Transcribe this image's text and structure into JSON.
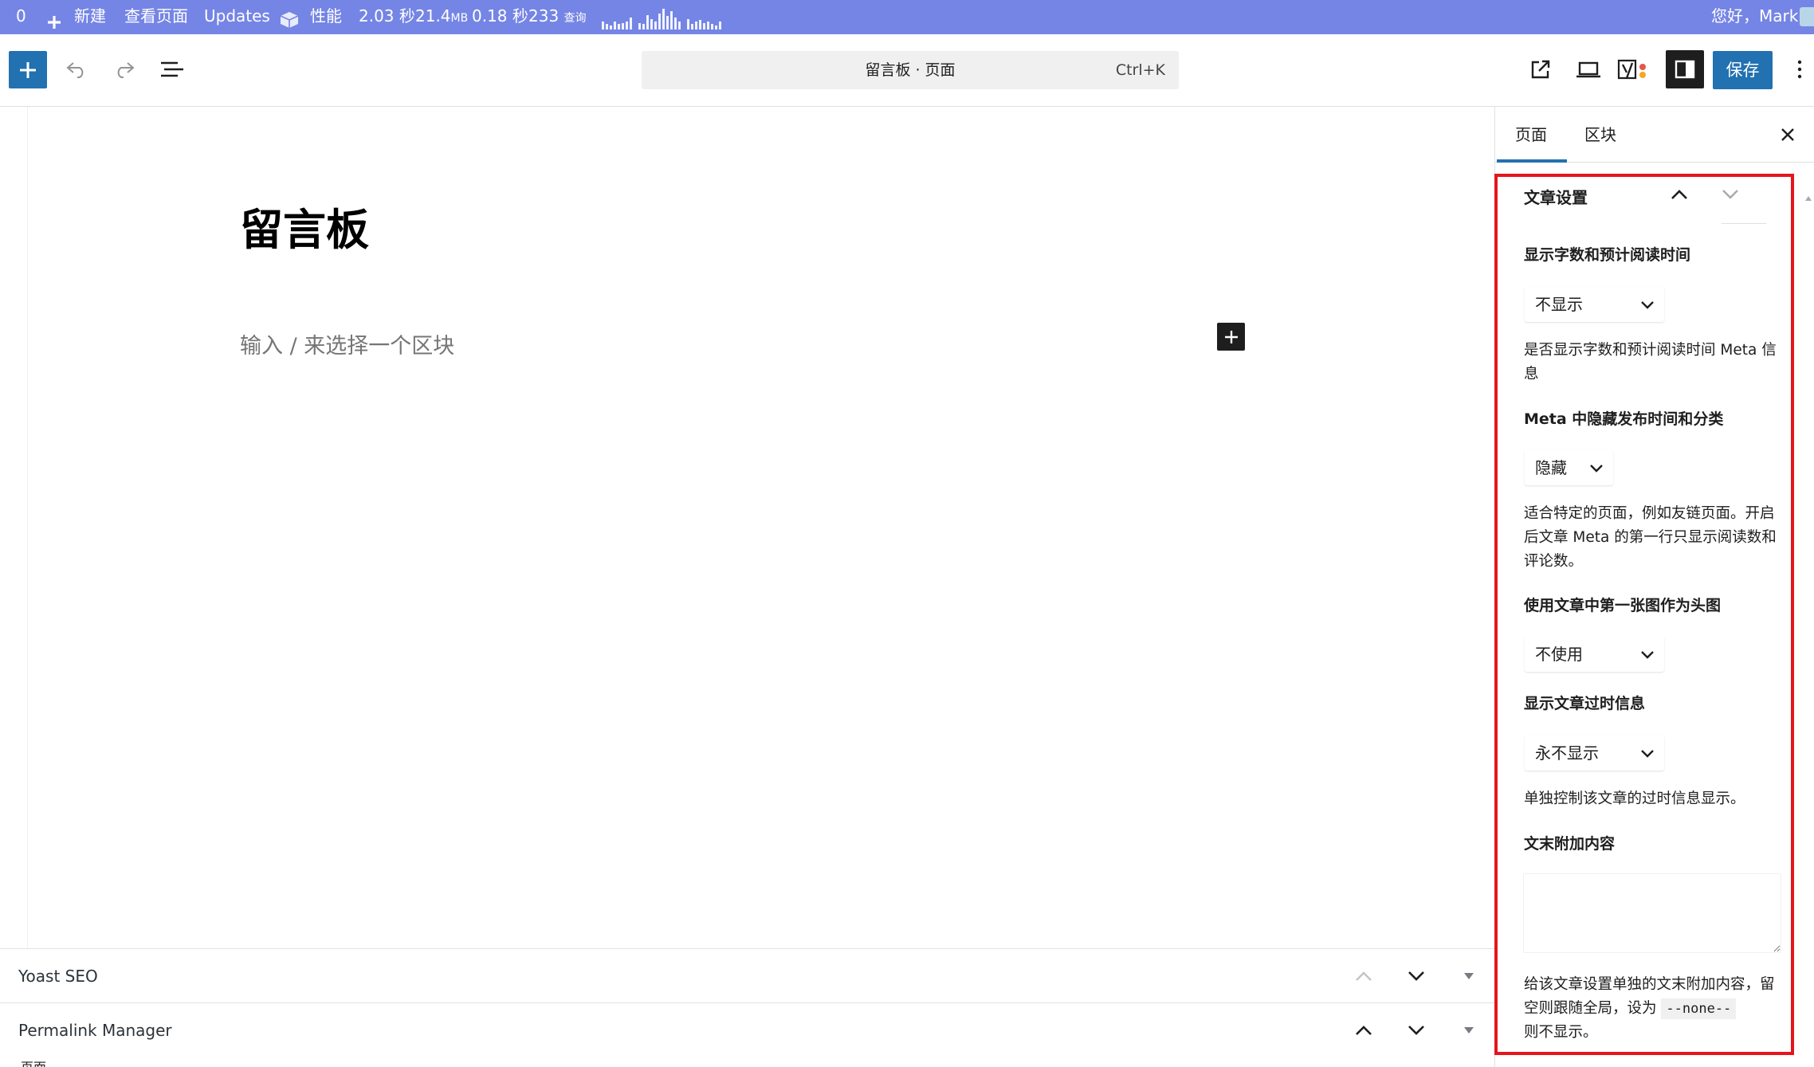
{
  "admin_bar": {
    "counter": "0",
    "new_label": "新建",
    "view_page": "查看页面",
    "updates": "Updates",
    "performance": "性能",
    "time_seconds": "2.03 秒",
    "memory": "21.4",
    "memory_unit": "MB",
    "query_time": "0.18 秒",
    "query_count": "233",
    "query_unit": "查询",
    "greeting": "您好，Mark",
    "qm_bar_levels": [
      0.3,
      0.2,
      0.15,
      0.3,
      0.2,
      0.25,
      0.3,
      0.45,
      0.25,
      0.2,
      0.55,
      0.4,
      0.3,
      0.6,
      0.8,
      0.5,
      0.7,
      0.45,
      0.3,
      0.4,
      0.2,
      0.3,
      0.35,
      0.25,
      0.3,
      0.2,
      0.15,
      0.3
    ]
  },
  "header": {
    "document_title": "留言板 · 页面",
    "shortcut": "Ctrl+K",
    "save_label": "保存",
    "accent_color": "#2271b1"
  },
  "canvas": {
    "post_title": "留言板",
    "block_placeholder": "输入 / 来选择一个区块"
  },
  "metaboxes": [
    {
      "label": "Yoast SEO"
    },
    {
      "label": "Permalink Manager"
    }
  ],
  "status_text": "页面",
  "sidebar": {
    "tabs": [
      {
        "label": "页面",
        "active": true
      },
      {
        "label": "区块",
        "active": false
      }
    ],
    "panel_title": "文章设置",
    "settings": {
      "word_count_heading": "显示字数和预计阅读时间",
      "word_count_value": "不显示",
      "word_count_help": "是否显示字数和预计阅读时间 Meta 信息",
      "meta_hide_heading": "Meta 中隐藏发布时间和分类",
      "meta_hide_value": "隐藏",
      "meta_hide_help": "适合特定的页面，例如友链页面。开启后文章 Meta 的第一行只显示阅读数和评论数。",
      "first_image_heading": "使用文章中第一张图作为头图",
      "first_image_value": "不使用",
      "outdated_heading": "显示文章过时信息",
      "outdated_value": "永不显示",
      "outdated_help": "单独控制该文章的过时信息显示。",
      "append_heading": "文末附加内容",
      "append_value": "",
      "append_help_1": "给该文章设置单独的文末附加内容，留空则跟随全局，设为",
      "append_help_code": "--none--",
      "append_help_2": "则不显示。"
    }
  },
  "highlight_color": "#e4151c"
}
